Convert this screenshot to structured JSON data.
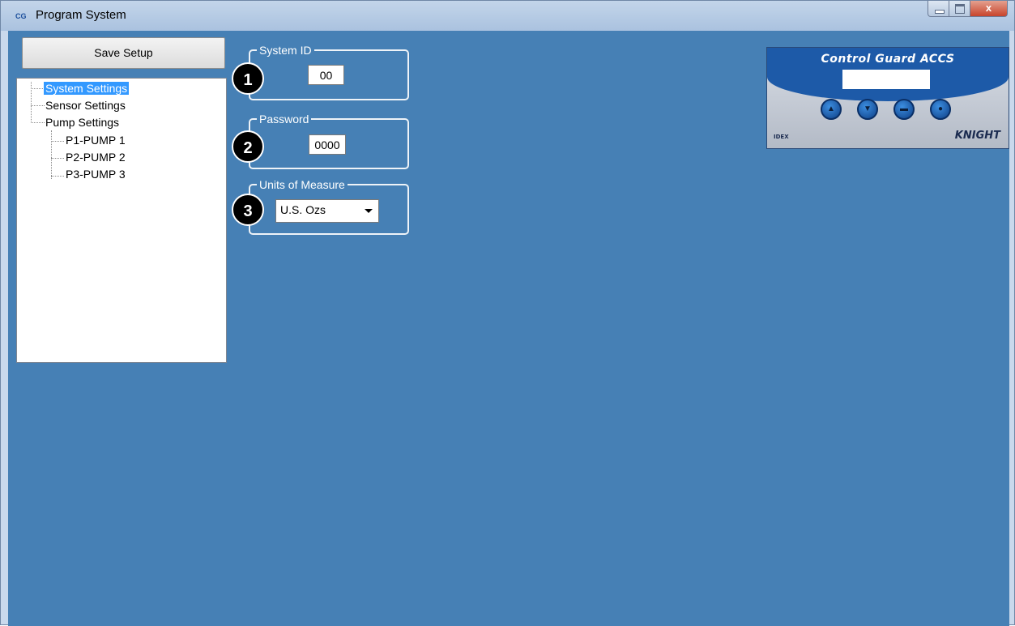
{
  "window": {
    "title": "Program System",
    "app_icon": "CG"
  },
  "title_buttons": {
    "close": "x"
  },
  "toolbar": {
    "save_label": "Save Setup"
  },
  "tree": {
    "system_settings": "System Settings",
    "sensor_settings": "Sensor Settings",
    "pump_settings": "Pump Settings",
    "pumps": [
      "P1-PUMP 1",
      "P2-PUMP 2",
      "P3-PUMP 3"
    ]
  },
  "system_id": {
    "legend": "System ID",
    "value": "00",
    "badge": "1"
  },
  "password": {
    "legend": "Password",
    "value": "0000",
    "badge": "2"
  },
  "units": {
    "legend": "Units of Measure",
    "selected": "U.S. Ozs",
    "badge": "3"
  },
  "panel": {
    "title": "Control Guard ACCS",
    "brand": "KNIGHT",
    "logo": "IDEX",
    "buttons": [
      "up-arrow-icon",
      "down-arrow-icon",
      "equals-icon",
      "minus-icon"
    ]
  },
  "colors": {
    "client_bg": "#4680b5",
    "selection": "#3399ff",
    "panel_blue": "#1d5aa8"
  }
}
